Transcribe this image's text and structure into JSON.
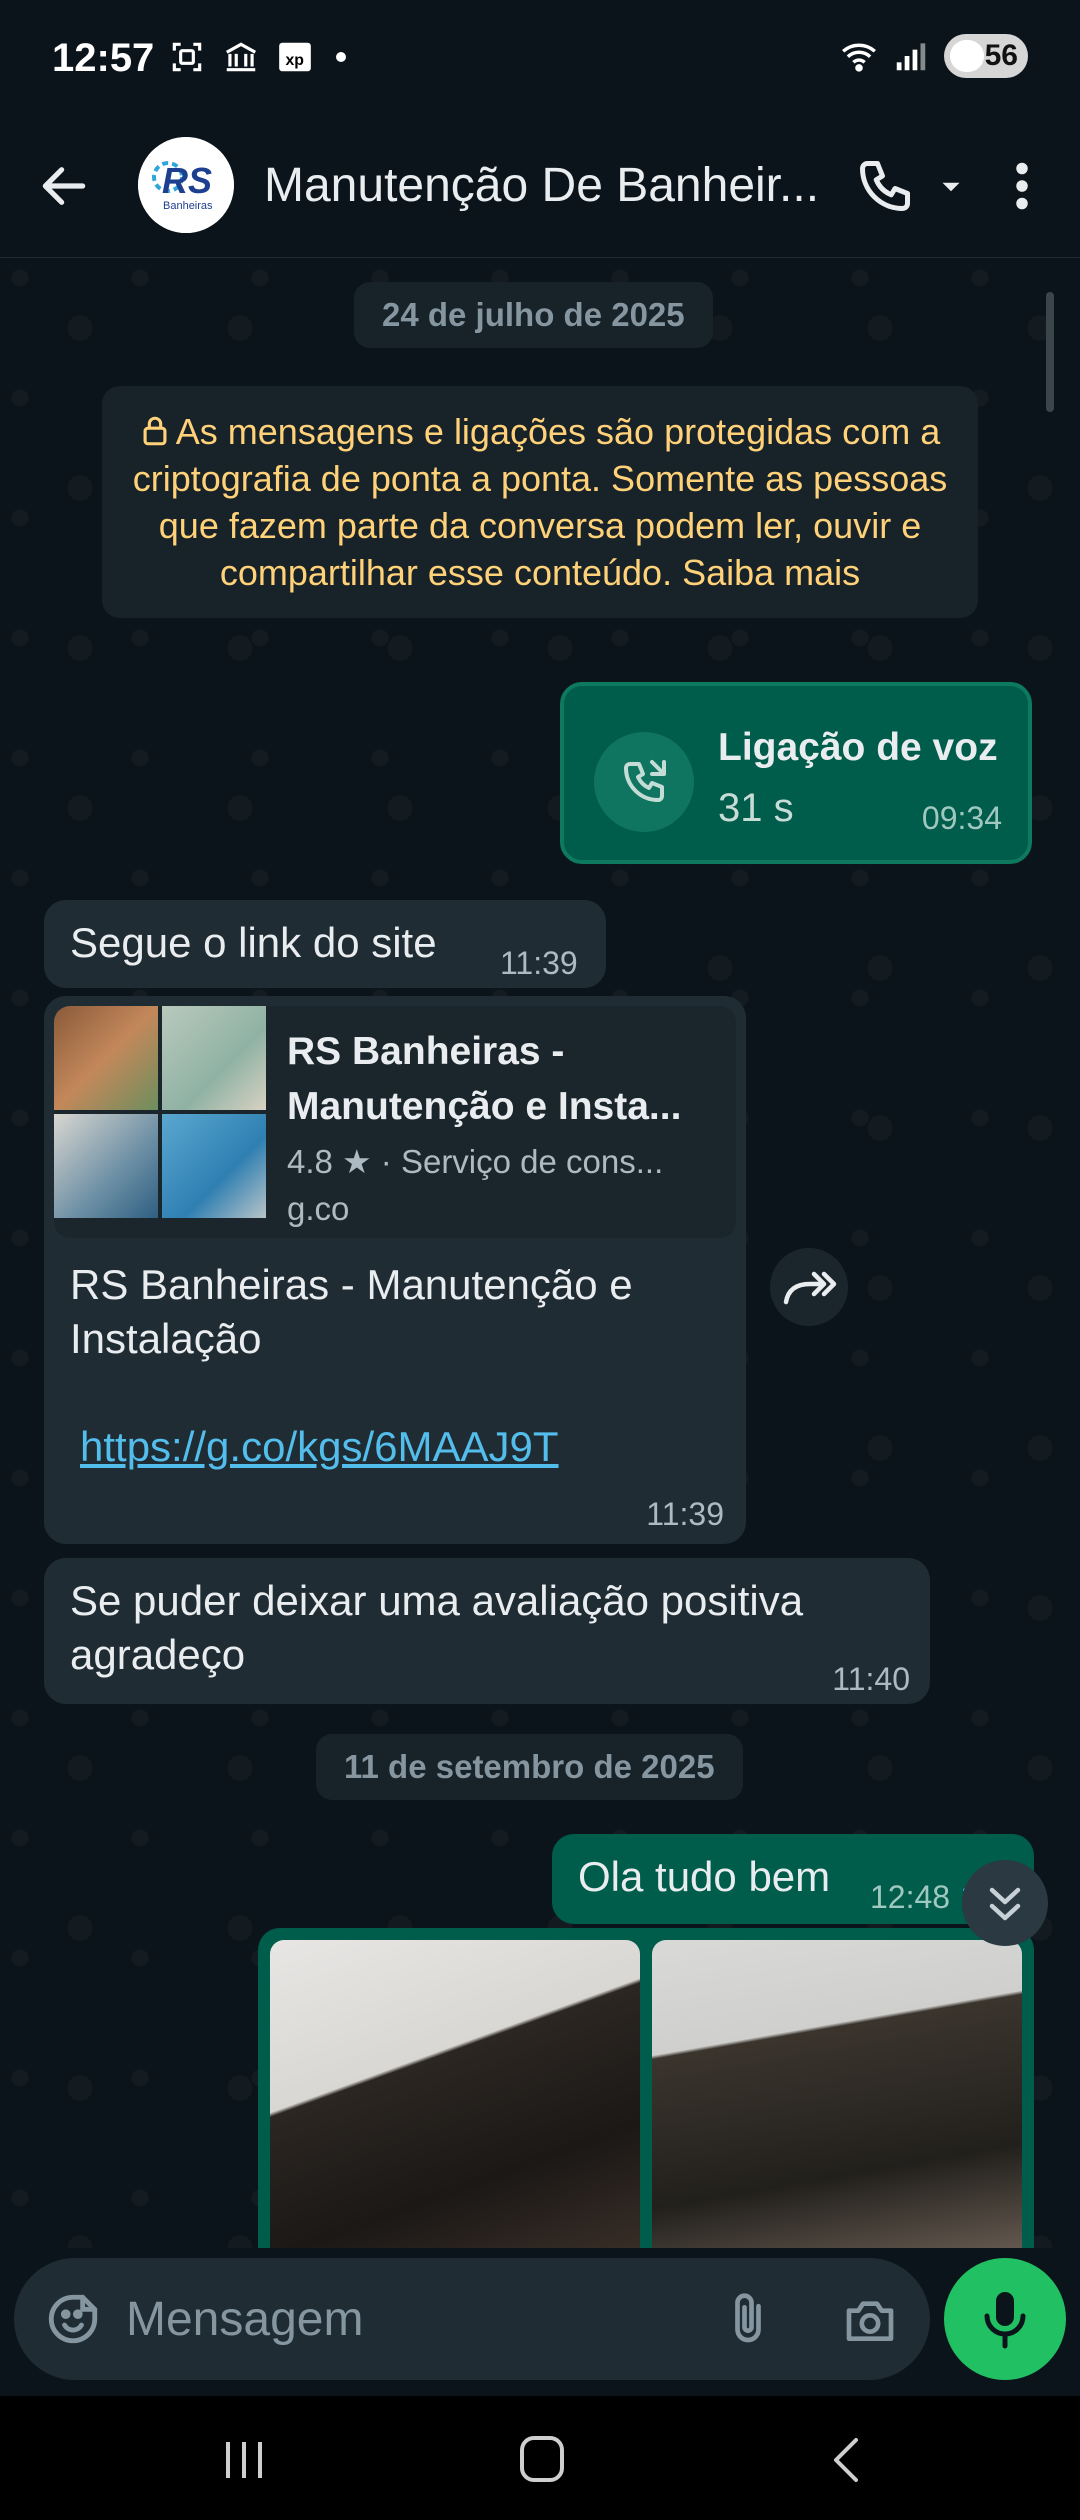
{
  "status_bar": {
    "time": "12:57",
    "battery": "56"
  },
  "header": {
    "contact_name": "Manutenção De Banheir...",
    "avatar_text": "RS",
    "avatar_subtext": "Banheiras"
  },
  "chat": {
    "date_1": "24 de julho de 2025",
    "encryption_notice": "As mensagens e ligações são protegidas com a criptografia de ponta a ponta. Somente as pessoas que fazem parte da conversa podem ler, ouvir e compartilhar esse conteúdo. Saiba mais",
    "voice_call": {
      "title": "Ligação de voz",
      "duration": "31 s",
      "time": "09:34"
    },
    "msg_link_intro": {
      "text": "Segue o link do site",
      "time": "11:39"
    },
    "link_preview": {
      "title_line1": "RS Banheiras -",
      "title_line2": "Manutenção e Insta...",
      "subtitle": "4.8 ★ · Serviço de cons...",
      "domain": "g.co",
      "body_line1": "RS Banheiras - Manutenção e",
      "body_line2": "Instalação",
      "url": "https://g.co/kgs/6MAAJ9T",
      "time": "11:39"
    },
    "msg_review": {
      "line1": "Se puder deixar uma avaliação positiva",
      "line2": "agradeço",
      "time": "11:40"
    },
    "date_2": "11 de setembro de 2025",
    "msg_hello": {
      "text": "Ola tudo bem",
      "time": "12:48"
    }
  },
  "input": {
    "placeholder": "Mensagem"
  }
}
